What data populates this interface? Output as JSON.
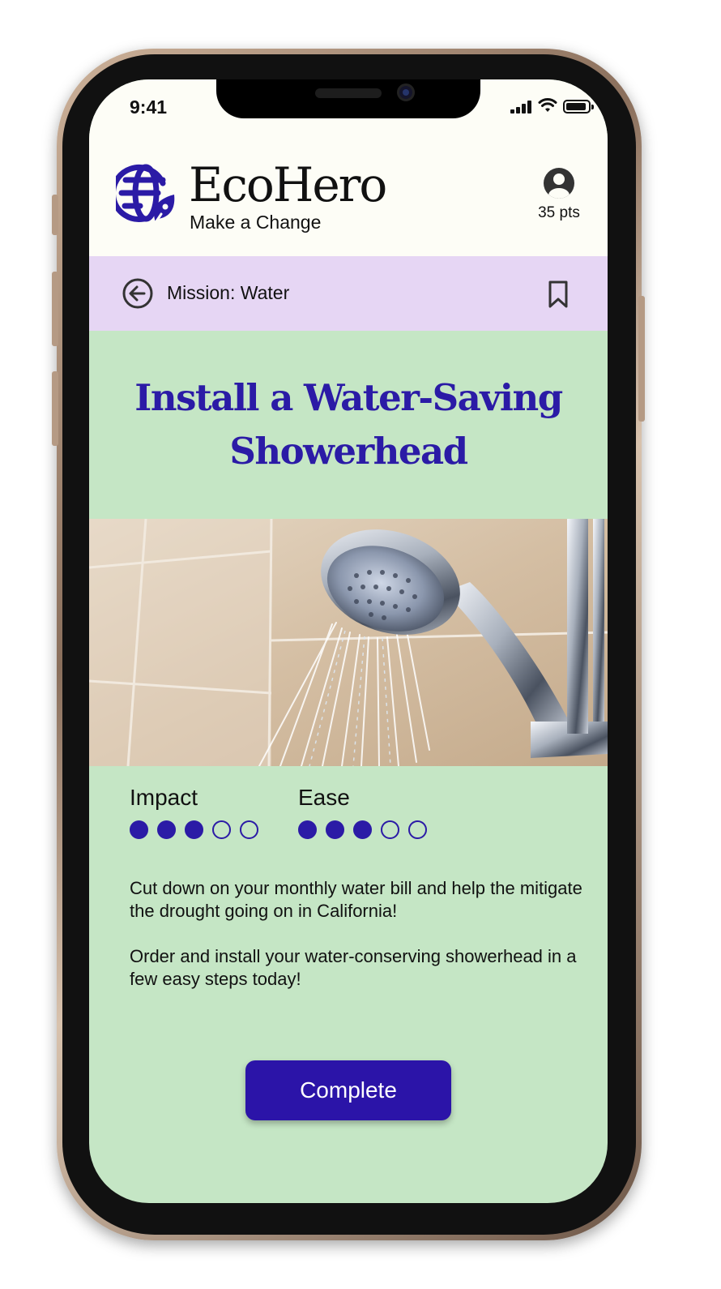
{
  "status_bar": {
    "time": "9:41"
  },
  "header": {
    "app_name": "EcoHero",
    "tagline": "Make a Change",
    "points": "35 pts"
  },
  "mission_bar": {
    "title": "Mission: Water"
  },
  "main": {
    "headline": "Install a Water-Saving Showerhead",
    "ratings": [
      {
        "label": "Impact",
        "value": 3,
        "max": 5
      },
      {
        "label": "Ease",
        "value": 3,
        "max": 5
      }
    ],
    "description": [
      "Cut down on your monthly water bill and help the mitigate the drought going on in California!",
      "Order and install your water-conserving showerhead in a few easy steps today!"
    ],
    "complete_label": "Complete"
  },
  "colors": {
    "accent": "#2b1ba6",
    "header_bg": "#fdfdf6",
    "mission_bar_bg": "#e6d6f4",
    "content_bg": "#c5e6c5"
  }
}
